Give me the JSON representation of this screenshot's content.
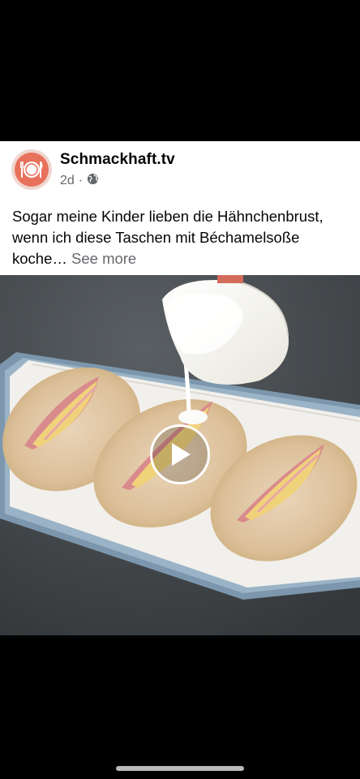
{
  "post": {
    "page_name": "Schmackhaft.tv",
    "time": "2d",
    "audience_icon": "globe-icon",
    "caption": "Sogar meine Kinder lieben die Hähnchenbrust, wenn ich diese Taschen mit Béchamelsoße koche…",
    "see_more": "See more"
  },
  "media": {
    "type": "video",
    "play_icon": "play-icon"
  },
  "colors": {
    "card_background": "#ffffff",
    "primary_text": "#050505",
    "secondary_text": "#65676b",
    "avatar_accent": "#e8715c",
    "screen_background": "#000000"
  }
}
